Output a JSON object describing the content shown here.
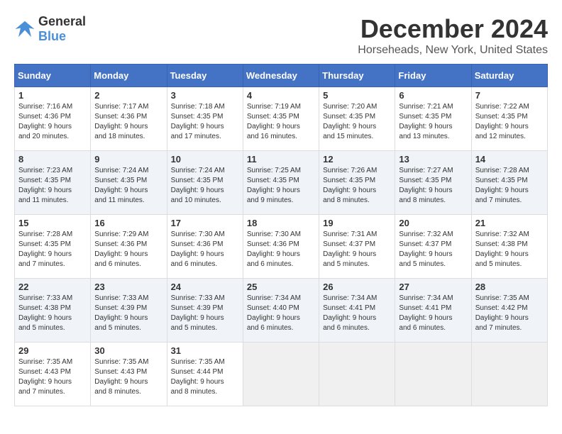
{
  "logo": {
    "general": "General",
    "blue": "Blue"
  },
  "title": "December 2024",
  "location": "Horseheads, New York, United States",
  "days_of_week": [
    "Sunday",
    "Monday",
    "Tuesday",
    "Wednesday",
    "Thursday",
    "Friday",
    "Saturday"
  ],
  "weeks": [
    [
      {
        "day": "1",
        "info": "Sunrise: 7:16 AM\nSunset: 4:36 PM\nDaylight: 9 hours\nand 20 minutes."
      },
      {
        "day": "2",
        "info": "Sunrise: 7:17 AM\nSunset: 4:36 PM\nDaylight: 9 hours\nand 18 minutes."
      },
      {
        "day": "3",
        "info": "Sunrise: 7:18 AM\nSunset: 4:35 PM\nDaylight: 9 hours\nand 17 minutes."
      },
      {
        "day": "4",
        "info": "Sunrise: 7:19 AM\nSunset: 4:35 PM\nDaylight: 9 hours\nand 16 minutes."
      },
      {
        "day": "5",
        "info": "Sunrise: 7:20 AM\nSunset: 4:35 PM\nDaylight: 9 hours\nand 15 minutes."
      },
      {
        "day": "6",
        "info": "Sunrise: 7:21 AM\nSunset: 4:35 PM\nDaylight: 9 hours\nand 13 minutes."
      },
      {
        "day": "7",
        "info": "Sunrise: 7:22 AM\nSunset: 4:35 PM\nDaylight: 9 hours\nand 12 minutes."
      }
    ],
    [
      {
        "day": "8",
        "info": "Sunrise: 7:23 AM\nSunset: 4:35 PM\nDaylight: 9 hours\nand 11 minutes."
      },
      {
        "day": "9",
        "info": "Sunrise: 7:24 AM\nSunset: 4:35 PM\nDaylight: 9 hours\nand 11 minutes."
      },
      {
        "day": "10",
        "info": "Sunrise: 7:24 AM\nSunset: 4:35 PM\nDaylight: 9 hours\nand 10 minutes."
      },
      {
        "day": "11",
        "info": "Sunrise: 7:25 AM\nSunset: 4:35 PM\nDaylight: 9 hours\nand 9 minutes."
      },
      {
        "day": "12",
        "info": "Sunrise: 7:26 AM\nSunset: 4:35 PM\nDaylight: 9 hours\nand 8 minutes."
      },
      {
        "day": "13",
        "info": "Sunrise: 7:27 AM\nSunset: 4:35 PM\nDaylight: 9 hours\nand 8 minutes."
      },
      {
        "day": "14",
        "info": "Sunrise: 7:28 AM\nSunset: 4:35 PM\nDaylight: 9 hours\nand 7 minutes."
      }
    ],
    [
      {
        "day": "15",
        "info": "Sunrise: 7:28 AM\nSunset: 4:35 PM\nDaylight: 9 hours\nand 7 minutes."
      },
      {
        "day": "16",
        "info": "Sunrise: 7:29 AM\nSunset: 4:36 PM\nDaylight: 9 hours\nand 6 minutes."
      },
      {
        "day": "17",
        "info": "Sunrise: 7:30 AM\nSunset: 4:36 PM\nDaylight: 9 hours\nand 6 minutes."
      },
      {
        "day": "18",
        "info": "Sunrise: 7:30 AM\nSunset: 4:36 PM\nDaylight: 9 hours\nand 6 minutes."
      },
      {
        "day": "19",
        "info": "Sunrise: 7:31 AM\nSunset: 4:37 PM\nDaylight: 9 hours\nand 5 minutes."
      },
      {
        "day": "20",
        "info": "Sunrise: 7:32 AM\nSunset: 4:37 PM\nDaylight: 9 hours\nand 5 minutes."
      },
      {
        "day": "21",
        "info": "Sunrise: 7:32 AM\nSunset: 4:38 PM\nDaylight: 9 hours\nand 5 minutes."
      }
    ],
    [
      {
        "day": "22",
        "info": "Sunrise: 7:33 AM\nSunset: 4:38 PM\nDaylight: 9 hours\nand 5 minutes."
      },
      {
        "day": "23",
        "info": "Sunrise: 7:33 AM\nSunset: 4:39 PM\nDaylight: 9 hours\nand 5 minutes."
      },
      {
        "day": "24",
        "info": "Sunrise: 7:33 AM\nSunset: 4:39 PM\nDaylight: 9 hours\nand 5 minutes."
      },
      {
        "day": "25",
        "info": "Sunrise: 7:34 AM\nSunset: 4:40 PM\nDaylight: 9 hours\nand 6 minutes."
      },
      {
        "day": "26",
        "info": "Sunrise: 7:34 AM\nSunset: 4:41 PM\nDaylight: 9 hours\nand 6 minutes."
      },
      {
        "day": "27",
        "info": "Sunrise: 7:34 AM\nSunset: 4:41 PM\nDaylight: 9 hours\nand 6 minutes."
      },
      {
        "day": "28",
        "info": "Sunrise: 7:35 AM\nSunset: 4:42 PM\nDaylight: 9 hours\nand 7 minutes."
      }
    ],
    [
      {
        "day": "29",
        "info": "Sunrise: 7:35 AM\nSunset: 4:43 PM\nDaylight: 9 hours\nand 7 minutes."
      },
      {
        "day": "30",
        "info": "Sunrise: 7:35 AM\nSunset: 4:43 PM\nDaylight: 9 hours\nand 8 minutes."
      },
      {
        "day": "31",
        "info": "Sunrise: 7:35 AM\nSunset: 4:44 PM\nDaylight: 9 hours\nand 8 minutes."
      },
      {
        "day": "",
        "info": ""
      },
      {
        "day": "",
        "info": ""
      },
      {
        "day": "",
        "info": ""
      },
      {
        "day": "",
        "info": ""
      }
    ]
  ]
}
